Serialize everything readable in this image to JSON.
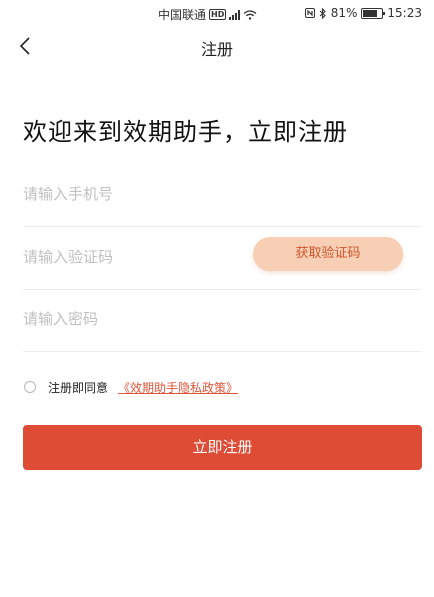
{
  "status_bar": {
    "carrier": "中国联通",
    "network": "HD",
    "battery": "81%",
    "time": "15:23"
  },
  "nav": {
    "title": "注册"
  },
  "welcome_text": "欢迎来到效期助手，立即注册",
  "form": {
    "phone_placeholder": "请输入手机号",
    "code_placeholder": "请输入验证码",
    "get_code_label": "获取验证码",
    "password_placeholder": "请输入密码"
  },
  "agreement": {
    "text": "注册即同意",
    "policy_link": "《效期助手隐私政策》"
  },
  "register_button": "立即注册",
  "colors": {
    "accent": "#de4c36",
    "code_button_bg": "#f6cfb4",
    "link": "#e0553a"
  }
}
